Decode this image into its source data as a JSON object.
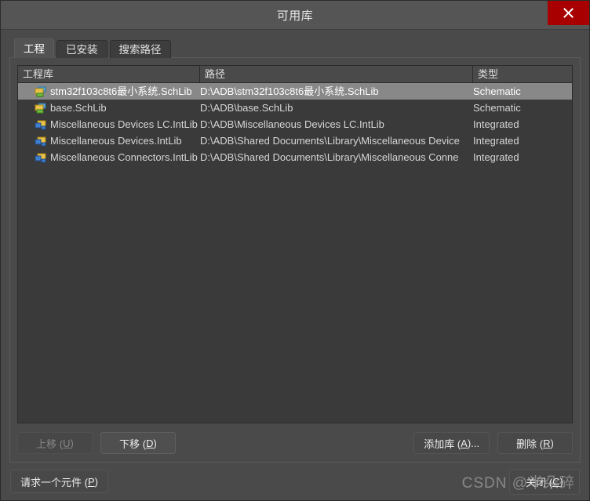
{
  "window": {
    "title": "可用库",
    "close_icon": "close-icon"
  },
  "tabs": [
    {
      "label": "工程",
      "active": true
    },
    {
      "label": "已安装",
      "active": false
    },
    {
      "label": "搜索路径",
      "active": false
    }
  ],
  "list": {
    "columns": [
      {
        "label": "工程库"
      },
      {
        "label": "路径"
      },
      {
        "label": "类型"
      }
    ],
    "rows": [
      {
        "icon": "schlib-icon",
        "name": "stm32f103c8t6最小系统.SchLib",
        "path": "D:\\ADB\\stm32f103c8t6最小系统.SchLib",
        "type": "Schematic",
        "selected": true
      },
      {
        "icon": "schlib-icon",
        "name": "base.SchLib",
        "path": "D:\\ADB\\base.SchLib",
        "type": "Schematic",
        "selected": false
      },
      {
        "icon": "intlib-icon",
        "name": "Miscellaneous Devices LC.IntLib",
        "path": "D:\\ADB\\Miscellaneous Devices LC.IntLib",
        "type": "Integrated",
        "selected": false
      },
      {
        "icon": "intlib-icon",
        "name": "Miscellaneous Devices.IntLib",
        "path": "D:\\ADB\\Shared Documents\\Library\\Miscellaneous Device",
        "type": "Integrated",
        "selected": false
      },
      {
        "icon": "intlib-icon",
        "name": "Miscellaneous Connectors.IntLib",
        "path": "D:\\ADB\\Shared Documents\\Library\\Miscellaneous Conne",
        "type": "Integrated",
        "selected": false
      }
    ]
  },
  "buttons": {
    "move_up": {
      "label": "上移 (U)",
      "text": "上移 (",
      "accel": "U",
      "tail": ")",
      "enabled": false
    },
    "move_down": {
      "label": "下移 (D)",
      "text": "下移 (",
      "accel": "D",
      "tail": ")",
      "enabled": true
    },
    "add_library": {
      "label": "添加库 (A)...",
      "text": "添加库 (",
      "accel": "A",
      "tail": ")...",
      "enabled": true
    },
    "remove": {
      "label": "删除 (R)",
      "text": "删除 (",
      "accel": "R",
      "tail": ")",
      "enabled": true
    },
    "request_component": {
      "label": "请求一个元件 (P)",
      "text": "请求一个元件 (",
      "accel": "P",
      "tail": ")",
      "enabled": true
    },
    "close": {
      "label": "关闭 (C)",
      "text": "关闭 (",
      "accel": "C",
      "tail": ")",
      "enabled": true
    }
  },
  "watermark": {
    "text": "CSDN @半朵碎"
  },
  "colors": {
    "accent_close": "#a80000",
    "titlebar": "#555555",
    "window_bg": "#4a4a4a",
    "list_bg": "#3a3a3a",
    "selection": "#888888"
  }
}
